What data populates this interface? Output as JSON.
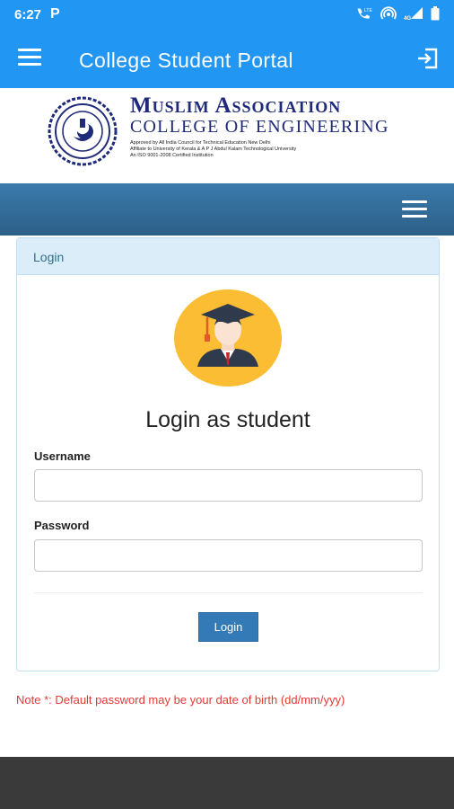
{
  "status_bar": {
    "time": "6:27",
    "app_indicator": "P",
    "icons": [
      "volte-icon",
      "hotspot-icon",
      "signal-4g-icon",
      "battery-icon"
    ],
    "network_label": "4G"
  },
  "app_bar": {
    "title": "College Student Portal",
    "menu_icon": "hamburger-menu-icon",
    "exit_icon": "exit-icon"
  },
  "college": {
    "name_line1": "Muslim Association",
    "name_line2": "COLLEGE OF ENGINEERING",
    "affiliations": [
      "Approved by All India Council for Technical Education New Delhi",
      "Affiliate to University of Kerala & A P J Abdul Kalam Technological University",
      "An ISO 9001-2008 Certified Institution"
    ]
  },
  "panel": {
    "header": "Login",
    "heading": "Login as student",
    "username_label": "Username",
    "username_value": "",
    "password_label": "Password",
    "password_value": "",
    "login_button": "Login"
  },
  "note": "Note *: Default password may be your date of birth (dd/mm/yyy)",
  "colors": {
    "primary": "#2196f3",
    "nav_strip": "#2c5f86",
    "panel_header_bg": "#dbedf8",
    "button": "#337ab7",
    "note": "#e53935",
    "avatar_bg": "#fbbd33"
  }
}
